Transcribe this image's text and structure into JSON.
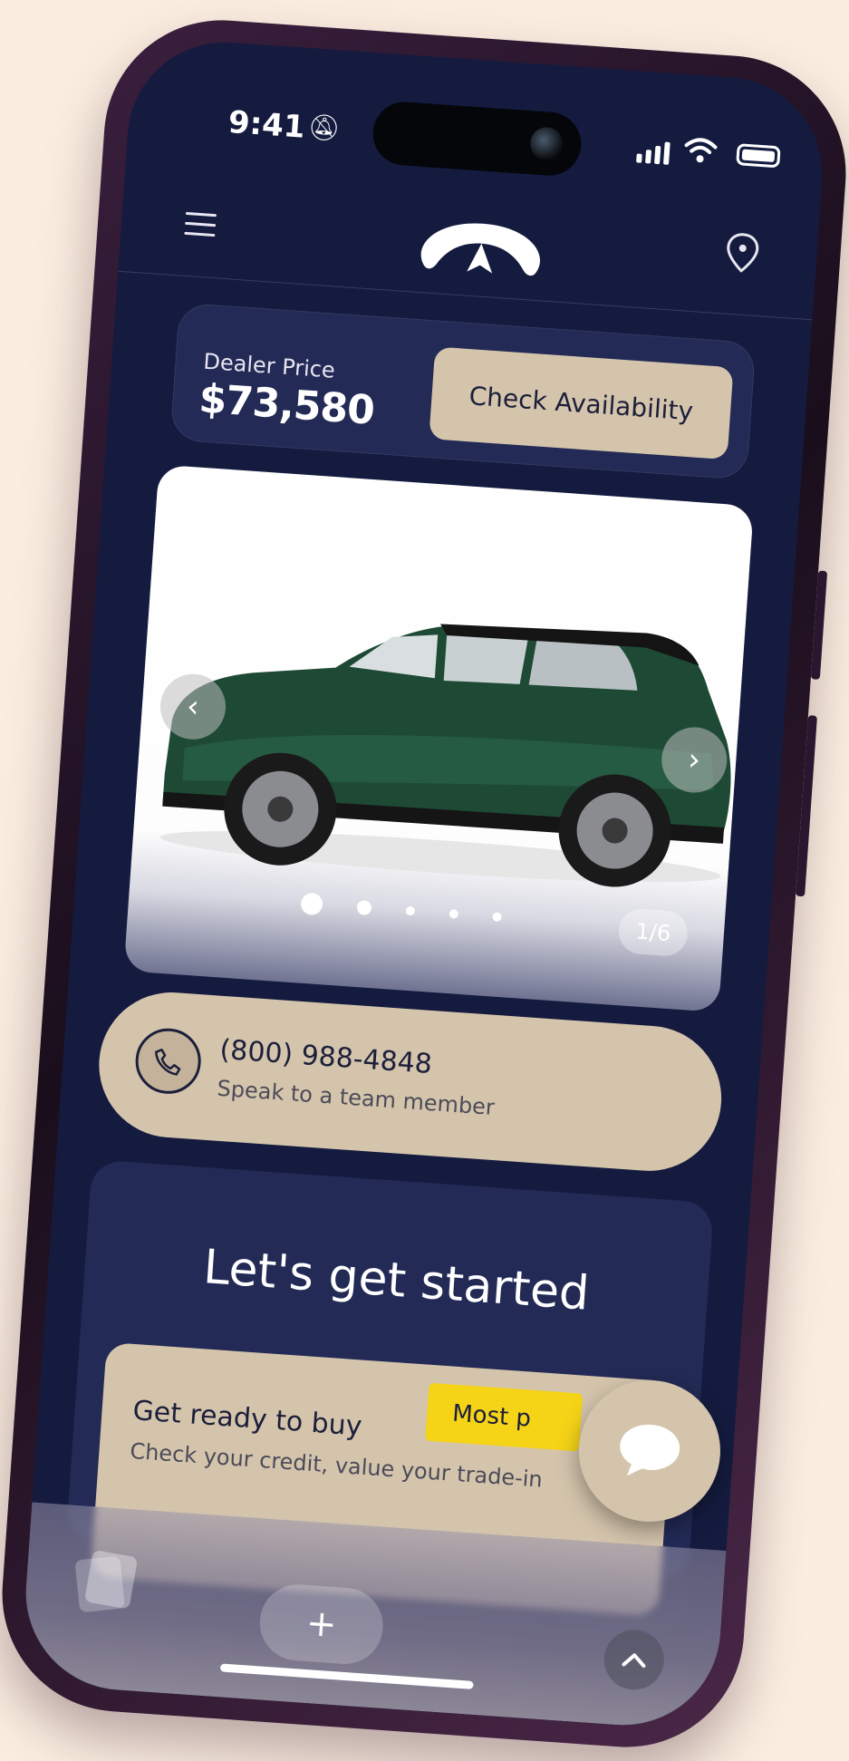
{
  "status_bar": {
    "time": "9:41"
  },
  "header": {
    "brand_logo": "infiniti-logo",
    "menu_icon": "hamburger-menu-icon",
    "location_icon": "location-pin-icon"
  },
  "price_card": {
    "label": "Dealer Price",
    "price": "$73,580",
    "cta_label": "Check Availability"
  },
  "gallery": {
    "counter": "1/6",
    "dots_total": 5,
    "active_dot": 0,
    "prev_icon": "‹",
    "next_icon": "›"
  },
  "contact": {
    "phone": "(800) 988-4848",
    "subtitle": "Speak to a team member"
  },
  "get_started": {
    "title": "Let's get started",
    "card": {
      "title": "Get ready to buy",
      "subtitle": "Check your credit, value your trade-in",
      "badge": "Most p"
    }
  },
  "bottom_bar": {
    "plus_label": "+"
  },
  "colors": {
    "screen_bg": "#141b3f",
    "card_bg": "#222a55",
    "accent_tan": "#d4c4ac",
    "badge_yellow": "#f5d417",
    "page_bg": "#fbeee0"
  }
}
